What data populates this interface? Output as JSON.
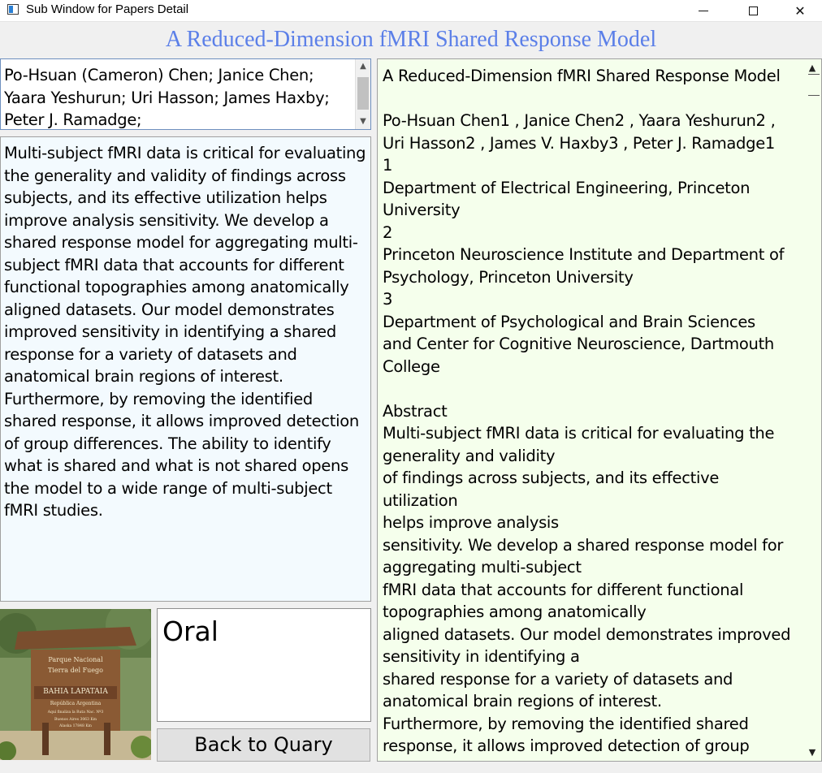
{
  "window": {
    "title": "Sub Window for Papers Detail",
    "controls": {
      "minimize": "minimize",
      "maximize": "maximize",
      "close": "✕"
    }
  },
  "paper": {
    "title": "A Reduced-Dimension fMRI Shared Response Model",
    "authors": "Po-Hsuan (Cameron) Chen; Janice Chen;\nYaara Yeshurun; Uri Hasson; James Haxby;\nPeter J. Ramadge;",
    "abstract": "Multi-subject fMRI data is critical for evaluating the generality and validity of findings across subjects, and its effective utilization helps improve analysis sensitivity. We develop a shared response model for aggregating multi-subject fMRI data that accounts for different functional topographies among anatomically aligned datasets. Our model demonstrates improved sensitivity in identifying a shared response for a variety of datasets and anatomical brain regions of interest. Furthermore, by removing the identified shared response, it allows improved detection of group differences. The ability to identify what is shared and what is not shared opens the model to a wide range of multi-subject fMRI studies.",
    "presentation_type": "Oral",
    "full_text": "A Reduced-Dimension fMRI Shared Response Model\n\nPo-Hsuan Chen1 , Janice Chen2 , Yaara Yeshurun2 ,\nUri Hasson2 , James V. Haxby3 , Peter J. Ramadge1\n1\nDepartment of Electrical Engineering, Princeton\nUniversity\n2\nPrinceton Neuroscience Institute and Department of\nPsychology, Princeton University\n3\nDepartment of Psychological and Brain Sciences\nand Center for Cognitive Neuroscience, Dartmouth\nCollege\n\nAbstract\nMulti-subject fMRI data is critical for evaluating the\ngenerality and validity\nof findings across subjects, and its effective utilization\nhelps improve analysis\nsensitivity. We develop a shared response model for\naggregating multi-subject\nfMRI data that accounts for different functional\ntopographies among anatomically\naligned datasets. Our model demonstrates improved\nsensitivity in identifying a\nshared response for a variety of datasets and\nanatomical brain regions of interest.\nFurthermore, by removing the identified shared\nresponse, it allows improved detection of group\ndifferences. The ability to identify what is shared and"
  },
  "photo": {
    "sign_lines": [
      "Parque Nacional",
      "Tierra del Fuego",
      "BAHIA LAPATAIA",
      "República Argentina",
      "Aquí finaliza la Ruta Nac. Nº3",
      "Buenos Aires 3063 Km",
      "Alaska 17848 Km"
    ]
  },
  "buttons": {
    "back": "Back to Quary"
  },
  "colors": {
    "title": "#5b7fe8",
    "abstract_bg": "#f3fafe",
    "fulltext_bg": "#f5ffec",
    "authors_border": "#6e8fbf"
  }
}
